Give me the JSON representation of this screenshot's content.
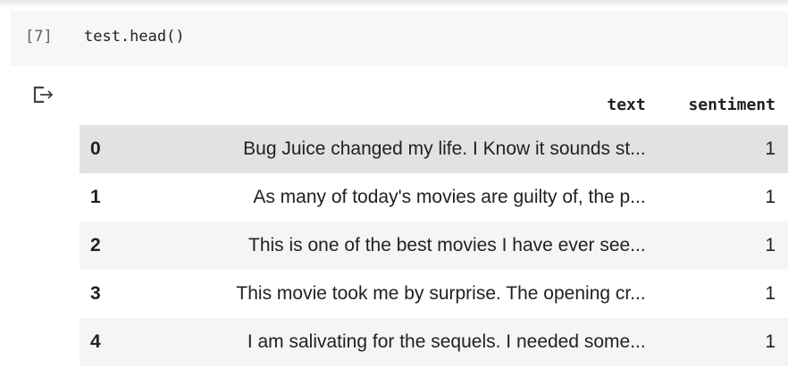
{
  "cell": {
    "execution_count": "[7]",
    "code": "test.head()"
  },
  "output": {
    "icon": "output-arrow-icon",
    "table": {
      "columns": [
        "",
        "text",
        "sentiment"
      ],
      "rows": [
        {
          "index": "0",
          "text": "Bug Juice changed my life. I Know it sounds st...",
          "sentiment": "1"
        },
        {
          "index": "1",
          "text": "As many of today's movies are guilty of, the p...",
          "sentiment": "1"
        },
        {
          "index": "2",
          "text": "This is one of the best movies I have ever see...",
          "sentiment": "1"
        },
        {
          "index": "3",
          "text": "This movie took me by surprise. The opening cr...",
          "sentiment": "1"
        },
        {
          "index": "4",
          "text": "I am salivating for the sequels. I needed some...",
          "sentiment": "1"
        }
      ]
    }
  },
  "colors": {
    "code_cell_bg": "#f7f7f7",
    "row_stripe": "#f5f5f5",
    "row_hover": "#e2e2e2"
  }
}
